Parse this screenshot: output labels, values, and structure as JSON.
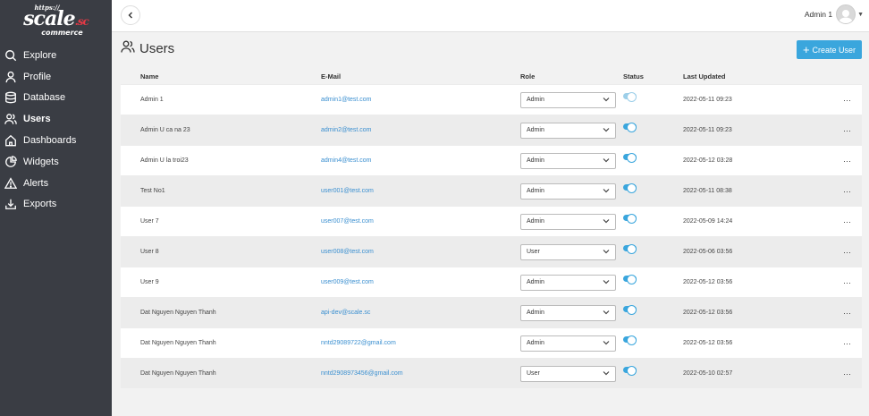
{
  "logo": {
    "top": "https://",
    "main": "scale",
    "dot": ".sc",
    "sub": "commerce"
  },
  "sidebar": {
    "items": [
      {
        "label": "Explore",
        "icon": "search-icon",
        "active": false
      },
      {
        "label": "Profile",
        "icon": "user-icon",
        "active": false
      },
      {
        "label": "Database",
        "icon": "database-icon",
        "active": false
      },
      {
        "label": "Users",
        "icon": "users-icon",
        "active": true
      },
      {
        "label": "Dashboards",
        "icon": "home-icon",
        "active": false
      },
      {
        "label": "Widgets",
        "icon": "pie-chart-icon",
        "active": false
      },
      {
        "label": "Alerts",
        "icon": "alert-triangle-icon",
        "active": false
      },
      {
        "label": "Exports",
        "icon": "download-icon",
        "active": false
      }
    ]
  },
  "topbar": {
    "user_name": "Admin 1"
  },
  "page": {
    "title": "Users",
    "create_label": "Create User"
  },
  "table": {
    "headers": {
      "name": "Name",
      "email": "E-Mail",
      "role": "Role",
      "status": "Status",
      "updated": "Last Updated"
    },
    "rows": [
      {
        "name": "Admin 1",
        "email": "admin1@test.com",
        "role": "Admin",
        "status": "faded",
        "updated": "2022-05-11 09:23"
      },
      {
        "name": "Admin U ca na 23",
        "email": "admin2@test.com",
        "role": "Admin",
        "status": "on",
        "updated": "2022-05-11 09:23"
      },
      {
        "name": "Admin U la troi23",
        "email": "admin4@test.com",
        "role": "Admin",
        "status": "on",
        "updated": "2022-05-12 03:28"
      },
      {
        "name": "Test No1",
        "email": "user001@test.com",
        "role": "Admin",
        "status": "on",
        "updated": "2022-05-11 08:38"
      },
      {
        "name": "User 7",
        "email": "user007@test.com",
        "role": "Admin",
        "status": "on",
        "updated": "2022-05-09 14:24"
      },
      {
        "name": "User 8",
        "email": "user008@test.com",
        "role": "User",
        "status": "on",
        "updated": "2022-05-06 03:56"
      },
      {
        "name": "User 9",
        "email": "user009@test.com",
        "role": "Admin",
        "status": "on",
        "updated": "2022-05-12 03:56"
      },
      {
        "name": "Dat Nguyen Nguyen Thanh",
        "email": "api-dev@scale.sc",
        "role": "Admin",
        "status": "on",
        "updated": "2022-05-12 03:56"
      },
      {
        "name": "Dat Nguyen Nguyen Thanh",
        "email": "nntd29089722@gmail.com",
        "role": "Admin",
        "status": "on",
        "updated": "2022-05-12 03:56"
      },
      {
        "name": "Dat Nguyen Nguyen Thanh",
        "email": "nntd2908973456@gmail.com",
        "role": "User",
        "status": "on",
        "updated": "2022-05-10 02:57"
      }
    ]
  },
  "colors": {
    "accent": "#3aa6dd",
    "sidebar_bg": "#3a3d44",
    "link": "#3a8fd0"
  }
}
